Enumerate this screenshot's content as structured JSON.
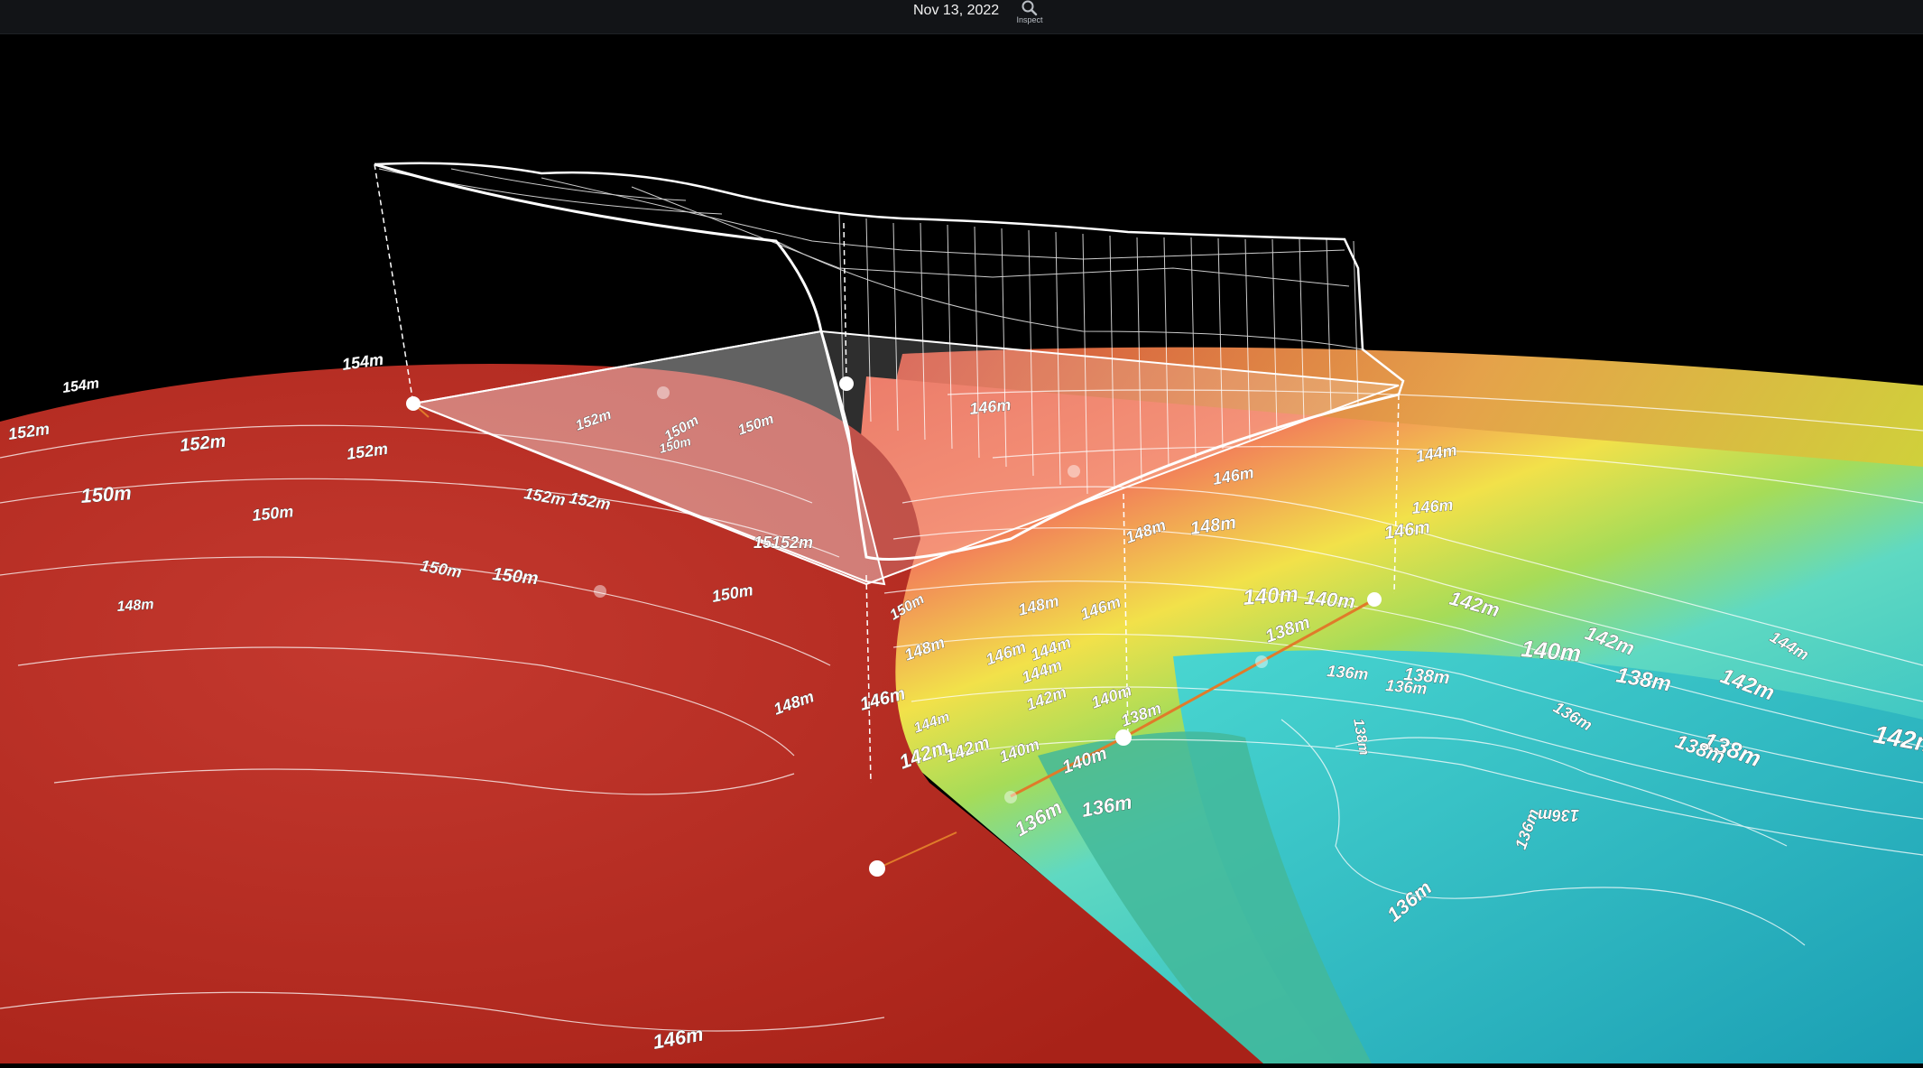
{
  "topbar": {
    "date": "Nov 13, 2022",
    "inspect_label": "Inspect",
    "inspect_icon": "magnifier-search-icon"
  },
  "scene": {
    "terrain_colors": {
      "high_elevation": "#c8352c",
      "mid_high": "#e8604a",
      "mid": "#f2e14a",
      "mid_low": "#9fd94a",
      "low": "#4ad6d2",
      "lowest": "#1aa8b8"
    },
    "contour_labels": [
      "154m",
      "154m",
      "152m",
      "152m",
      "152m",
      "150m",
      "150m",
      "150m",
      "152m",
      "152m",
      "150m",
      "150m",
      "150m",
      "148m",
      "150m",
      "152m",
      "150m",
      "150m",
      "15152m",
      "146m",
      "148m",
      "148m",
      "146m",
      "148m",
      "148m",
      "146m",
      "144m",
      "142m",
      "140m",
      "138m",
      "140m",
      "140m",
      "142m",
      "144m",
      "144m",
      "146m",
      "146m",
      "144m",
      "142m",
      "140m",
      "138m",
      "140m",
      "142m",
      "142m",
      "138m",
      "138m",
      "138m",
      "136m",
      "136m",
      "136m",
      "136m",
      "136m",
      "138m",
      "138m",
      "140m",
      "142m",
      "146m",
      "148m",
      "146m",
      "136m",
      "136m",
      "136m",
      "142m",
      "144m",
      "146m",
      "146m"
    ]
  }
}
